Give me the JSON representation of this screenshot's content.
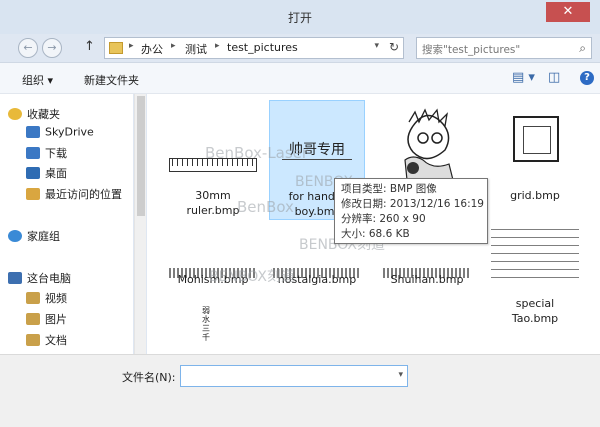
{
  "window": {
    "title": "打开",
    "close_symbol": "✕"
  },
  "address": {
    "back_symbol": "←",
    "forward_symbol": "→",
    "up_symbol": "↑",
    "breadcrumbs": [
      "办公",
      "测试",
      "test_pictures"
    ],
    "sep_symbol": "▸",
    "dropdown_symbol": "▾",
    "refresh_symbol": "↻"
  },
  "search": {
    "placeholder": "搜索\"test_pictures\"",
    "icon_symbol": "⌕"
  },
  "toolbar": {
    "organize_label": "组织 ▾",
    "new_folder_label": "新建文件夹",
    "view_symbol": "▤ ▾",
    "preview_symbol": "◫",
    "help_symbol": "?"
  },
  "sidebar": {
    "items": [
      {
        "label": "收藏夹",
        "icon": "star-icon",
        "color": "#e8b93a"
      },
      {
        "label": "SkyDrive",
        "icon": "cloud-folder-icon",
        "color": "#3b78c4"
      },
      {
        "label": "下载",
        "icon": "download-folder-icon",
        "color": "#3b78c4"
      },
      {
        "label": "桌面",
        "icon": "desktop-icon",
        "color": "#2f6cb3"
      },
      {
        "label": "最近访问的位置",
        "icon": "recent-places-icon",
        "color": "#d9a640"
      },
      {
        "label": "家庭组",
        "icon": "homegroup-icon",
        "color": "#3a8ad6"
      },
      {
        "label": "这台电脑",
        "icon": "computer-icon",
        "color": "#3d6fb0"
      },
      {
        "label": "视频",
        "icon": "video-folder-icon",
        "color": "#c9a04a"
      },
      {
        "label": "图片",
        "icon": "pictures-folder-icon",
        "color": "#c9a04a"
      },
      {
        "label": "文档",
        "icon": "documents-folder-icon",
        "color": "#c9a04a"
      }
    ]
  },
  "files": [
    {
      "name": "30mm ruler.bmp",
      "line1": "30mm",
      "line2": "ruler.bmp"
    },
    {
      "name": "for handsome boy.bmp",
      "line1": "for handso",
      "line2": "boy.bmp",
      "thumb_text": "帅哥专用"
    },
    {
      "name": "cartoon",
      "line1": "",
      "line2": ""
    },
    {
      "name": "grid.bmp",
      "line1": "grid.bmp",
      "line2": ""
    },
    {
      "name": "Mohism.bmp",
      "line1": "Mohism.bmp",
      "line2": ""
    },
    {
      "name": "nostalgia.bmp",
      "line1": "nostalgia.bmp",
      "line2": ""
    },
    {
      "name": "Shuihan.bmp",
      "line1": "Shuihan.bmp",
      "line2": ""
    },
    {
      "name": "special Tao.bmp",
      "line1": "special",
      "line2": "Tao.bmp"
    },
    {
      "name": "vertical",
      "line1": "",
      "line2": "",
      "thumb_text": "弱水三千"
    }
  ],
  "tooltip": {
    "lines": [
      "项目类型: BMP 图像",
      "修改日期: 2013/12/16 16:19",
      "分辨率: 260 x 90",
      "大小: 68.6 KB"
    ]
  },
  "watermarks": [
    "BenBox-Laser",
    "BenBox",
    "BENBOX",
    "BENBOX刻道",
    "BENBOX刻道"
  ],
  "bottom": {
    "filename_label": "文件名(N):",
    "filename_value": "",
    "dropdown_symbol": "▾"
  }
}
